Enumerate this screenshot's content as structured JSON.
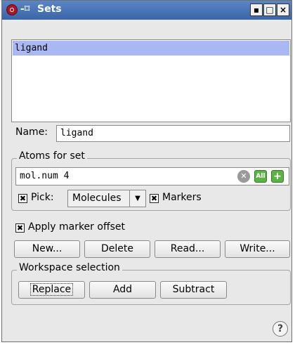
{
  "window": {
    "title": "Sets",
    "pin_glyph": "-⌑",
    "minimize": "▪",
    "maximize": "□",
    "close": "×"
  },
  "sets_list": {
    "items": [
      "ligand"
    ],
    "selected_index": 0
  },
  "name_field": {
    "label": "Name:",
    "value": "ligand"
  },
  "atoms_group": {
    "legend": "Atoms for set",
    "selection_value": "mol.num 4",
    "clear_icon": "clear-icon",
    "all_label": "All",
    "add_icon": "plus-icon",
    "pick_checked": true,
    "pick_label": "Pick:",
    "pick_mode": "Molecules",
    "markers_checked": true,
    "markers_label": "Markers"
  },
  "marker_offset": {
    "checked": true,
    "label": "Apply marker offset"
  },
  "actions": {
    "new": "New...",
    "delete": "Delete",
    "read": "Read...",
    "write": "Write..."
  },
  "workspace_group": {
    "legend": "Workspace selection",
    "replace": "Replace",
    "add": "Add",
    "subtract": "Subtract"
  },
  "help": {
    "glyph": "?"
  },
  "colors": {
    "titlebar": "#3a64a6",
    "selection": "#a9b8f2",
    "accent_green": "#5bb346"
  }
}
